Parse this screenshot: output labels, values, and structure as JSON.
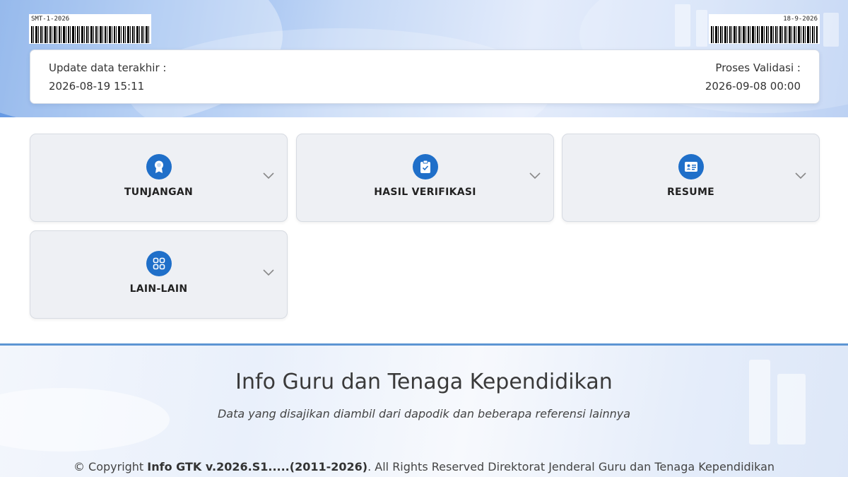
{
  "header": {
    "left_code": "SMT-1-2026",
    "right_code": "18-9-2026"
  },
  "update": {
    "last_update_label": "Update data terakhir :",
    "last_update_value": "2026-08-19 15:11",
    "validation_label": "Proses Validasi :",
    "validation_value": "2026-09-08 00:00"
  },
  "menu": [
    {
      "label": "TUNJANGAN",
      "icon": "award-icon"
    },
    {
      "label": "HASIL VERIFIKASI",
      "icon": "clipboard-check-icon"
    },
    {
      "label": "RESUME",
      "icon": "id-card-icon"
    },
    {
      "label": "LAIN-LAIN",
      "icon": "grid-icon"
    }
  ],
  "footer": {
    "title": "Info Guru dan Tenaga Kependidikan",
    "subtitle": "Data yang disajikan diambil dari dapodik dan beberapa referensi lainnya",
    "copyright_prefix": "© Copyright ",
    "copyright_brand": "Info GTK v.2026.S1.....(2011-2026)",
    "copyright_suffix": ". All Rights Reserved Direktorat Jenderal Guru dan Tenaga Kependidikan"
  },
  "colors": {
    "accent": "#1f6fc9",
    "footer_border": "#5d95d3"
  }
}
